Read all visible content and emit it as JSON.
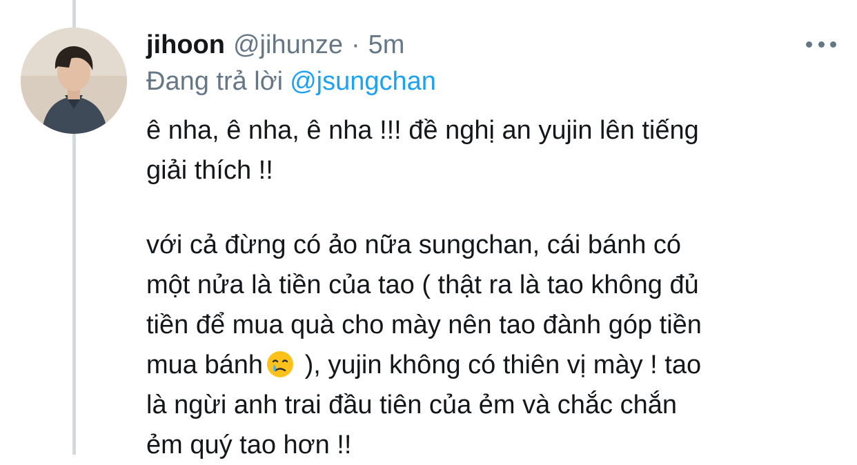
{
  "tweet": {
    "display_name": "jihoon",
    "handle": "@jihunze",
    "separator": "·",
    "time": "5m",
    "reply_prefix": "Đang trả lời",
    "reply_to": "@jsungchan",
    "lines": [
      "ê nha, ê nha, ê nha !!! đề nghị an yujin lên tiếng",
      "giải thích !!",
      "với cả đừng có ảo nữa sungchan, cái bánh có",
      "một nửa là tiền của tao ( thật ra là tao không đủ",
      "tiền để mua quà cho mày nên tao đành góp tiền",
      "mua bánh",
      " ), yujin không có thiên vị mày ! tao",
      "là ngừi anh trai đầu tiên của ẻm và chắc chắn",
      "ẻm quý tao hơn !!"
    ],
    "emoji": "crying-face-emoji"
  },
  "icons": {
    "more": "more-horizontal-icon",
    "avatar": "profile-avatar"
  },
  "colors": {
    "text": "#14171a",
    "secondary": "#657786",
    "link": "#1da1f2",
    "thread_line": "#d3d8dc"
  }
}
